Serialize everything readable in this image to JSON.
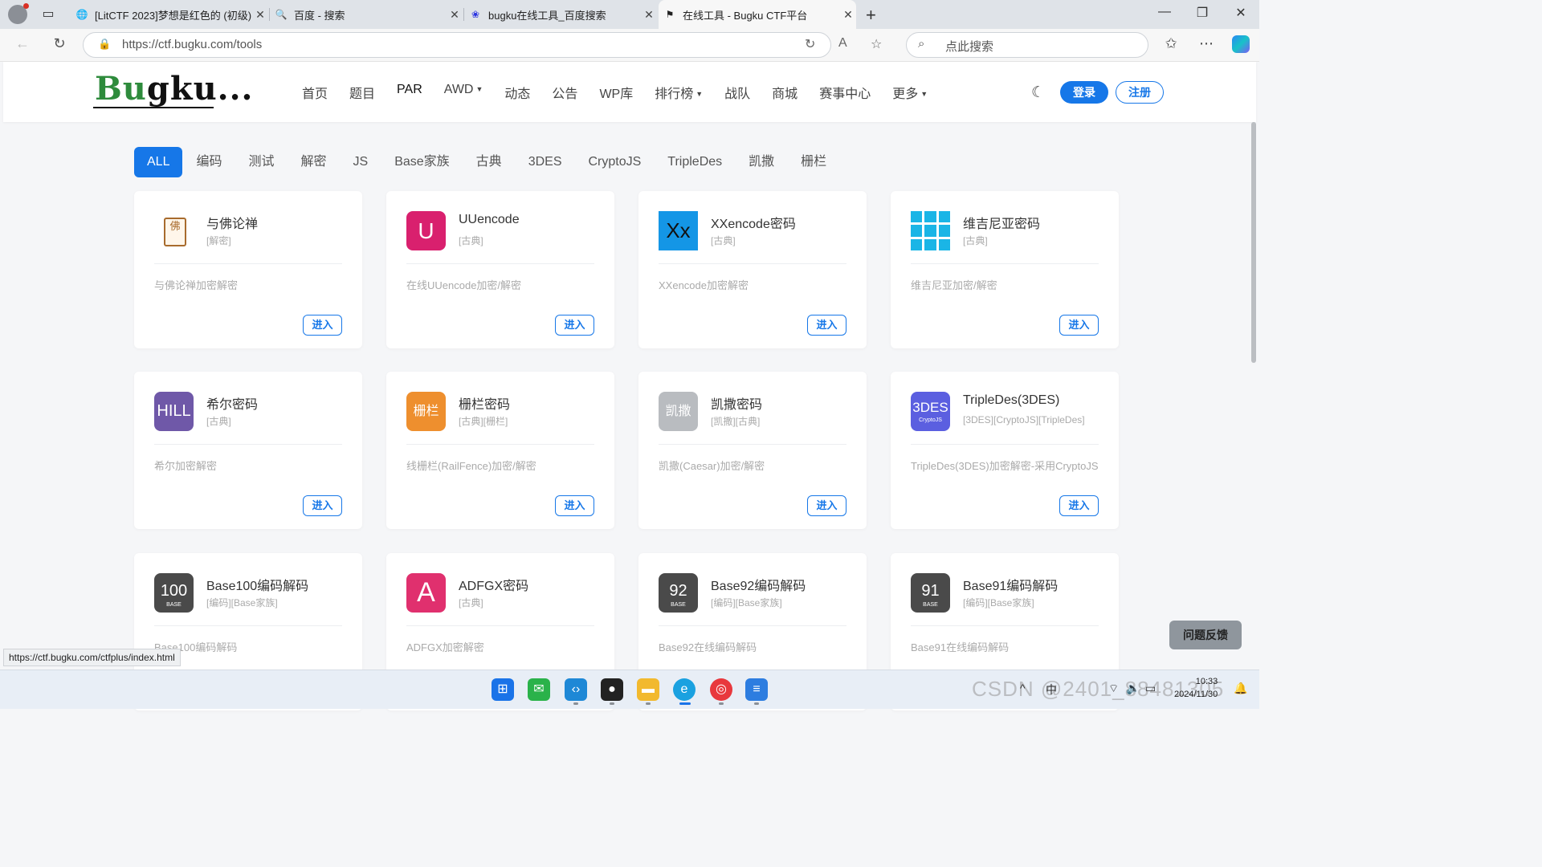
{
  "browser": {
    "tabs": [
      {
        "title": "[LitCTF 2023]梦想是红色的 (初级)",
        "icon": "globe-icon"
      },
      {
        "title": "百度 - 搜索",
        "icon": "search-icon"
      },
      {
        "title": "bugku在线工具_百度搜索",
        "icon": "baidu-paw-icon"
      },
      {
        "title": "在线工具 - Bugku CTF平台",
        "icon": "flag-icon"
      }
    ],
    "url": "https://ctf.bugku.com/tools",
    "search_placeholder": "点此搜索",
    "status_url": "https://ctf.bugku.com/ctfplus/index.html"
  },
  "site": {
    "logo": {
      "part1": "Bu",
      "part2": "gku..."
    },
    "nav": [
      "首页",
      "题目",
      "PAR",
      "AWD",
      "动态",
      "公告",
      "WP库",
      "排行榜",
      "战队",
      "商城",
      "赛事中心",
      "更多"
    ],
    "login": "登录",
    "register": "注册"
  },
  "filters": [
    "ALL",
    "编码",
    "测试",
    "解密",
    "JS",
    "Base家族",
    "古典",
    "3DES",
    "CryptoJS",
    "TripleDes",
    "凯撒",
    "栅栏"
  ],
  "enter_label": "进入",
  "cards": [
    {
      "title": "与佛论禅",
      "tag": "[解密]",
      "desc": "与佛论禅加密解密",
      "icon_text": "佛",
      "icon_color": "#a86b2d"
    },
    {
      "title": "UUencode",
      "tag": "[古典]",
      "desc": "在线UUencode加密/解密",
      "icon_text": "U",
      "icon_color": "#d9206e"
    },
    {
      "title": "XXencode密码",
      "tag": "[古典]",
      "desc": "XXencode加密解密",
      "icon_text": "Xx",
      "icon_color": "#1496e6"
    },
    {
      "title": "维吉尼亚密码",
      "tag": "[古典]",
      "desc": "维吉尼亚加密/解密",
      "icon_text": "",
      "icon_color": "#1ab5e6"
    },
    {
      "title": "希尔密码",
      "tag": "[古典]",
      "desc": "希尔加密解密",
      "icon_text": "HILL",
      "icon_color": "#6f58a8"
    },
    {
      "title": "栅栏密码",
      "tag": "[古典][栅栏]",
      "desc": "线栅栏(RailFence)加密/解密",
      "icon_text": "栅栏",
      "icon_color": "#ee8f2e"
    },
    {
      "title": "凯撒密码",
      "tag": "[凯撒][古典]",
      "desc": "凯撒(Caesar)加密/解密",
      "icon_text": "凯撒",
      "icon_color": "#b9bcc0"
    },
    {
      "title": "TripleDes(3DES)",
      "tag": "[3DES][CryptoJS][TripleDes]",
      "desc": "TripleDes(3DES)加密解密-采用CryptoJS",
      "icon_text": "3DES",
      "icon_sub": "CryptoJS",
      "icon_color": "#5b5fe0"
    },
    {
      "title": "Base100编码解码",
      "tag": "[编码][Base家族]",
      "desc": "Base100编码解码",
      "icon_text": "100",
      "icon_sub": "BASE",
      "icon_color": "#4a4a4a"
    },
    {
      "title": "ADFGX密码",
      "tag": "[古典]",
      "desc": "ADFGX加密解密",
      "icon_text": "A",
      "icon_color": "#e0306e"
    },
    {
      "title": "Base92编码解码",
      "tag": "[编码][Base家族]",
      "desc": "Base92在线编码解码",
      "icon_text": "92",
      "icon_sub": "BASE",
      "icon_color": "#4a4a4a"
    },
    {
      "title": "Base91编码解码",
      "tag": "[编码][Base家族]",
      "desc": "Base91在线编码解码",
      "icon_text": "91",
      "icon_sub": "BASE",
      "icon_color": "#4a4a4a"
    }
  ],
  "feedback": "问题反馈",
  "taskbar": {
    "time": "10:33",
    "date": "2024/11/30",
    "watermark": "CSDN @2401_88481305",
    "ime": "中"
  }
}
